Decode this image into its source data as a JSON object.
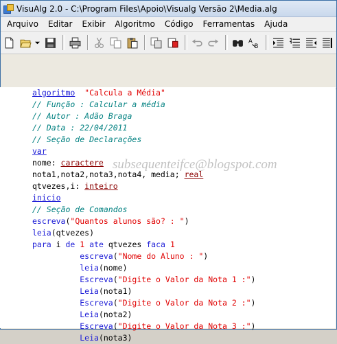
{
  "window": {
    "title": "VisuAlg 2.0 - C:\\Program Files\\Apoio\\Visualg Versão 2\\Media.alg"
  },
  "menu": {
    "items": [
      "Arquivo",
      "Editar",
      "Exibir",
      "Algoritmo",
      "Código",
      "Ferramentas",
      "Ajuda"
    ]
  },
  "toolbar": {
    "icons": [
      "new-file-icon",
      "open-folder-icon",
      "save-icon",
      "print-icon",
      "cut-icon",
      "copy-icon",
      "paste-icon",
      "copy-special-icon",
      "paste-special-icon",
      "undo-icon",
      "redo-icon",
      "find-icon",
      "replace-icon",
      "indent-icon",
      "numbered-list-icon",
      "outdent-icon",
      "rightmost-icon"
    ]
  },
  "editor": {
    "lines": [
      [
        [
          "kw",
          "algoritmo"
        ],
        [
          "",
          "  "
        ],
        [
          "str",
          "\"Calcula a Média\""
        ]
      ],
      [
        [
          "cm",
          "// Função : Calcular a média"
        ]
      ],
      [
        [
          "cm",
          "// Autor : Adão Braga"
        ]
      ],
      [
        [
          "cm",
          "// Data : 22/04/2011"
        ]
      ],
      [
        [
          "cm",
          "// Seção de Declarações"
        ]
      ],
      [
        [
          "kw",
          "var"
        ]
      ],
      [
        [
          "",
          "nome: "
        ],
        [
          "typ",
          "caractere"
        ]
      ],
      [
        [
          "",
          "nota1,nota2,nota3,nota4, media; "
        ],
        [
          "typ",
          "real"
        ]
      ],
      [
        [
          "",
          "qtvezes,i: "
        ],
        [
          "typ",
          "inteiro"
        ]
      ],
      [
        [
          "kw",
          "inicio"
        ]
      ],
      [
        [
          "cm",
          "// Seção de Comandos"
        ]
      ],
      [
        [
          "kwp",
          "escreva"
        ],
        [
          "",
          "("
        ],
        [
          "str",
          "\"Quantos alunos são? : \""
        ],
        [
          "",
          ")"
        ]
      ],
      [
        [
          "kwp",
          "leia"
        ],
        [
          "",
          "(qtvezes)"
        ]
      ],
      [
        [
          "kwp",
          "para"
        ],
        [
          "",
          " i "
        ],
        [
          "kwp",
          "de"
        ],
        [
          "",
          " "
        ],
        [
          "num",
          "1"
        ],
        [
          "",
          " "
        ],
        [
          "kwp",
          "ate"
        ],
        [
          "",
          " qtvezes "
        ],
        [
          "kwp",
          "faca"
        ],
        [
          "",
          " "
        ],
        [
          "num",
          "1"
        ]
      ],
      [
        [
          "",
          "          "
        ],
        [
          "kwp",
          "escreva"
        ],
        [
          "",
          "("
        ],
        [
          "str",
          "\"Nome do Aluno : \""
        ],
        [
          "",
          ")"
        ]
      ],
      [
        [
          "",
          "          "
        ],
        [
          "kwp",
          "leia"
        ],
        [
          "",
          "(nome)"
        ]
      ],
      [
        [
          "",
          "          "
        ],
        [
          "kwp",
          "Escreva"
        ],
        [
          "",
          "("
        ],
        [
          "str",
          "\"Digite o Valor da Nota 1 :\""
        ],
        [
          "",
          ")"
        ]
      ],
      [
        [
          "",
          "          "
        ],
        [
          "kwp",
          "Leia"
        ],
        [
          "",
          "(nota1)"
        ]
      ],
      [
        [
          "",
          "          "
        ],
        [
          "kwp",
          "Escreva"
        ],
        [
          "",
          "("
        ],
        [
          "str",
          "\"Digite o Valor da Nota 2 :\""
        ],
        [
          "",
          ")"
        ]
      ],
      [
        [
          "",
          "          "
        ],
        [
          "kwp",
          "Leia"
        ],
        [
          "",
          "(nota2)"
        ]
      ],
      [
        [
          "",
          "          "
        ],
        [
          "kwp",
          "Escreva"
        ],
        [
          "",
          "("
        ],
        [
          "str",
          "\"Digite o Valor da Nota 3 :\""
        ],
        [
          "",
          ")"
        ]
      ],
      [
        [
          "",
          "          "
        ],
        [
          "kwp",
          "Leia"
        ],
        [
          "",
          "(nota3)"
        ]
      ]
    ]
  },
  "watermark": "subsequenteifce@blogspot.com"
}
